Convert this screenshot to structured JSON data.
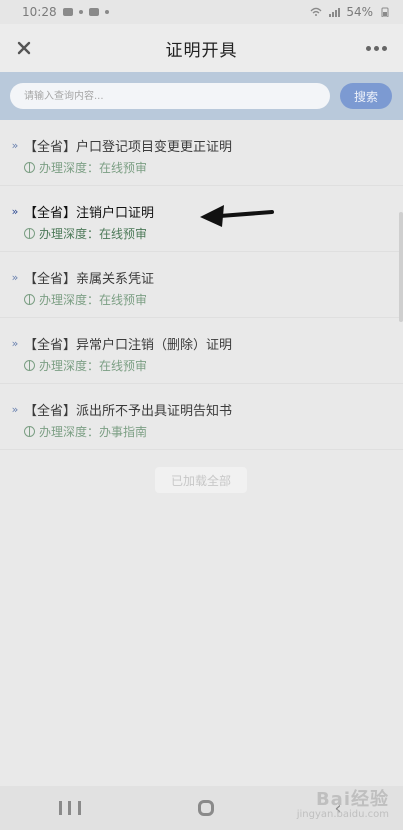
{
  "status_bar": {
    "time": "10:28",
    "battery": "54%"
  },
  "header": {
    "title": "证明开具",
    "close_icon": "close-icon",
    "more_icon": "more-icon"
  },
  "search": {
    "placeholder": "请输入查询内容...",
    "button_label": "搜索"
  },
  "items": [
    {
      "title": "【全省】户口登记项目变更更正证明",
      "depth": "办理深度：在线预审"
    },
    {
      "title": "【全省】注销户口证明",
      "depth": "办理深度：在线预审"
    },
    {
      "title": "【全省】亲属关系凭证",
      "depth": "办理深度：在线预审"
    },
    {
      "title": "【全省】异常户口注销（删除）证明",
      "depth": "办理深度：在线预审"
    },
    {
      "title": "【全省】派出所不予出具证明告知书",
      "depth": "办理深度：办事指南"
    }
  ],
  "footer": {
    "loaded_all": "已加载全部"
  },
  "watermark": {
    "brand": "Bai经验",
    "url": "jingyan.baidu.com"
  },
  "colors": {
    "accent_blue": "#7c9ad2",
    "searchbar_bg": "#b9c9db",
    "green_text": "#7c9f84",
    "chevron_blue": "#6b82b0"
  }
}
